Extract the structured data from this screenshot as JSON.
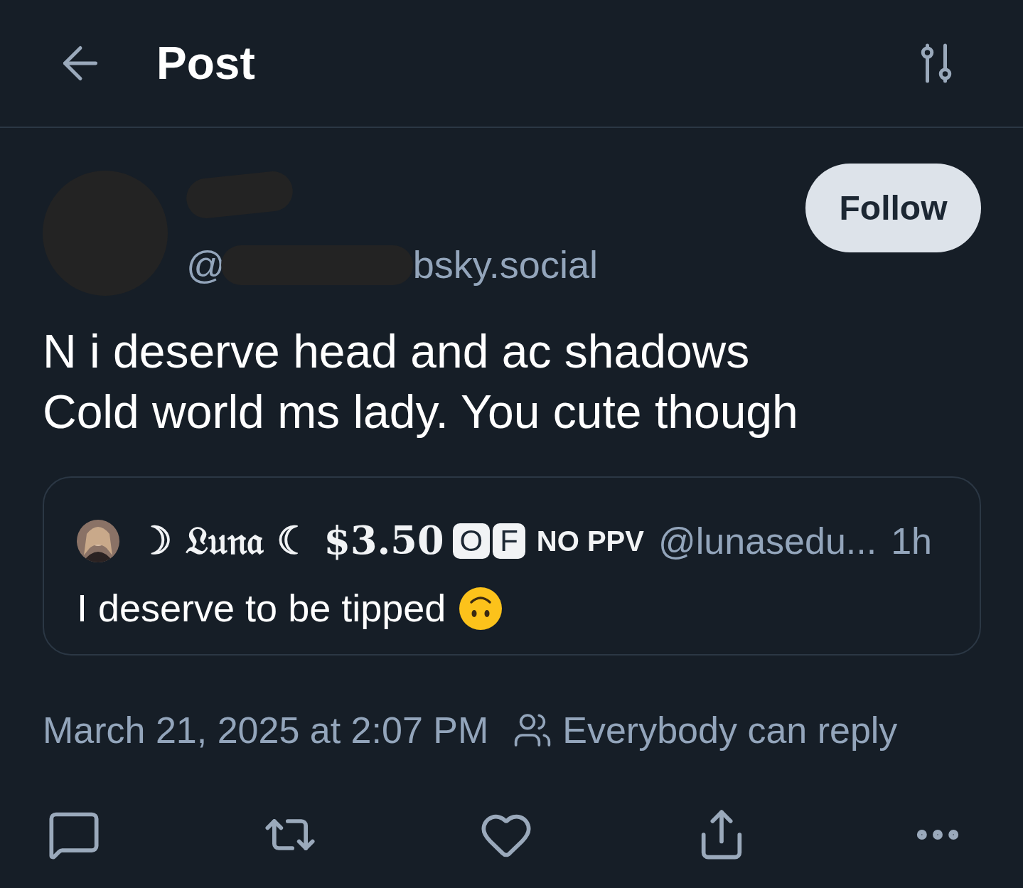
{
  "header": {
    "title": "Post"
  },
  "author": {
    "handle_prefix": "@",
    "handle_suffix": "bsky.social",
    "follow": "Follow"
  },
  "text_lines": [
    "N i deserve head and ac shadows",
    "Cold world ms lady. You cute though"
  ],
  "quote": {
    "name": [
      {
        "kind": "text",
        "text": "☽ 𝔏𝔲𝔫𝔞 ☾ $3.50"
      },
      {
        "kind": "key",
        "text": "O"
      },
      {
        "kind": "key",
        "text": "F"
      },
      {
        "kind": "small",
        "text": "NO PPV"
      }
    ],
    "handle": "@lunasedu...",
    "time": "1h",
    "text": "I deserve to be tipped"
  },
  "meta": {
    "date": "March 21, 2025 at 2:07 PM",
    "audience": "Everybody can reply"
  }
}
